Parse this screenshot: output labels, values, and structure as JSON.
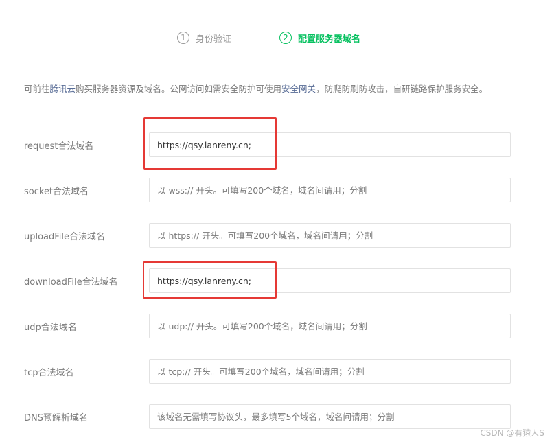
{
  "steps": [
    {
      "number": "1",
      "label": "身份验证"
    },
    {
      "number": "2",
      "label": "配置服务器域名"
    }
  ],
  "intro": {
    "prefix": "可前往",
    "link1": "腾讯云",
    "middle": "购买服务器资源及域名。公网访问如需安全防护可使用",
    "link2": "安全网关",
    "suffix": "，防爬防刷防攻击，自研链路保护服务安全。"
  },
  "fields": [
    {
      "label": "request合法域名",
      "value": "https://qsy.lanreny.cn;",
      "placeholder": ""
    },
    {
      "label": "socket合法域名",
      "value": "",
      "placeholder": "以 wss:// 开头。可填写200个域名，域名间请用；分割"
    },
    {
      "label": "uploadFile合法域名",
      "value": "",
      "placeholder": "以 https:// 开头。可填写200个域名，域名间请用；分割"
    },
    {
      "label": "downloadFile合法域名",
      "value": "https://qsy.lanreny.cn;",
      "placeholder": ""
    },
    {
      "label": "udp合法域名",
      "value": "",
      "placeholder": "以 udp:// 开头。可填写200个域名，域名间请用；分割"
    },
    {
      "label": "tcp合法域名",
      "value": "",
      "placeholder": "以 tcp:// 开头。可填写200个域名，域名间请用；分割"
    },
    {
      "label": "DNS预解析域名",
      "value": "",
      "placeholder": "该域名无需填写协议头，最多填写5个域名，域名间请用；分割"
    }
  ],
  "watermark": "CSDN @有猿人S",
  "colors": {
    "accent": "#07c160",
    "link": "#576b95",
    "highlight": "#e53935"
  }
}
